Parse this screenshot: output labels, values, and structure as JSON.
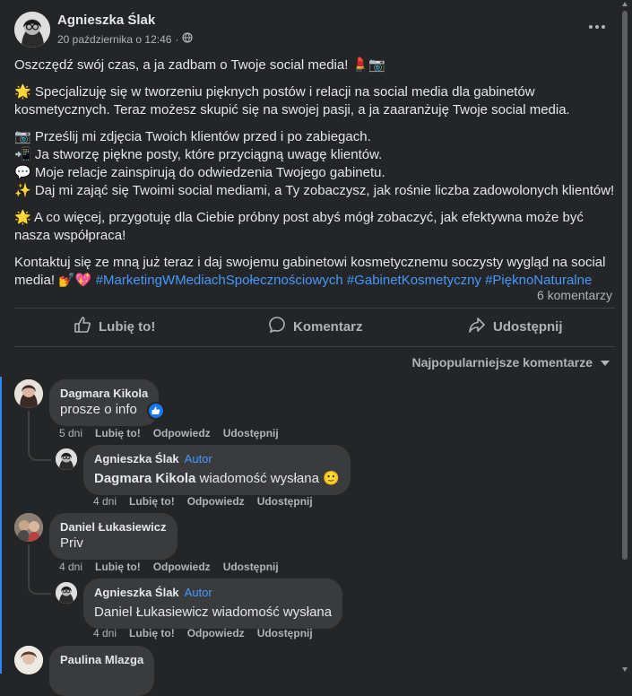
{
  "post": {
    "author": "Agnieszka Ślak",
    "date": "20 października o 12:46",
    "date_separator": "·",
    "globe_icon": "globe-icon",
    "more_icon": "more-options-icon",
    "paragraphs": {
      "p1": "Oszczędź swój czas, a ja zadbam o Twoje social media! 💄📷",
      "p2": "🌟 Specjalizuję się w tworzeniu pięknych postów i relacji na social media dla gabinetów kosmetycznych. Teraz możesz skupić się na swojej pasji, a ja zaaranżuję Twoje social media.",
      "p3_l1": "📷 Prześlij mi zdjęcia Twoich klientów przed i po zabiegach.",
      "p3_l2": "📲 Ja stworzę piękne posty, które przyciągną uwagę klientów.",
      "p3_l3": "💬 Moje relacje zainspirują do odwiedzenia Twojego gabinetu.",
      "p3_l4": "✨ Daj mi zająć się Twoimi social mediami, a Ty zobaczysz, jak rośnie liczba zadowolonych klientów!",
      "p4": "🌟 A co więcej, przygotuję dla Ciebie próbny post abyś mógł zobaczyć, jak efektywna może być nasza współpraca!",
      "p5_text": "Kontaktuj się ze mną już teraz i daj swojemu gabinetowi kosmetycznemu soczysty wygląd na social media! 💅💖 ",
      "p5_hashtags": "#MarketingWMediachSpołecznościowych #GabinetKosmetyczny #PięknoNaturalne"
    },
    "comments_count": "6 komentarzy"
  },
  "actions": {
    "like": "Lubię to!",
    "comment": "Komentarz",
    "share": "Udostępnij"
  },
  "sort": {
    "label": "Najpopularniejsze komentarze"
  },
  "comments": [
    {
      "name": "Dagmara Kikola",
      "text": "prosze o info",
      "age": "5 dni",
      "like": "Lubię to!",
      "reply": "Odpowiedz",
      "share": "Udostępnij",
      "reply_item": {
        "name": "Agnieszka Ślak",
        "badge": "Autor",
        "mention": "Dagmara Kikola",
        "text": " wiadomość wysłana 🙂",
        "age": "4 dni",
        "like": "Lubię to!",
        "reply": "Odpowiedz",
        "share": "Udostępnij"
      }
    },
    {
      "name": "Daniel Łukasiewicz",
      "text": "Priv",
      "age": "4 dni",
      "like": "Lubię to!",
      "reply": "Odpowiedz",
      "share": "Udostępnij",
      "reply_item": {
        "name": "Agnieszka Ślak",
        "badge": "Autor",
        "text": "Daniel Łukasiewicz wiadomość wysłana",
        "age": "4 dni",
        "like": "Lubię to!",
        "reply": "Odpowiedz",
        "share": "Udostępnij"
      }
    },
    {
      "name": "Paulina Mlazga"
    }
  ],
  "colors": {
    "background": "#242526",
    "bubble": "#3a3b3c",
    "link": "#4599ff",
    "like_badge": "#1877f2"
  }
}
